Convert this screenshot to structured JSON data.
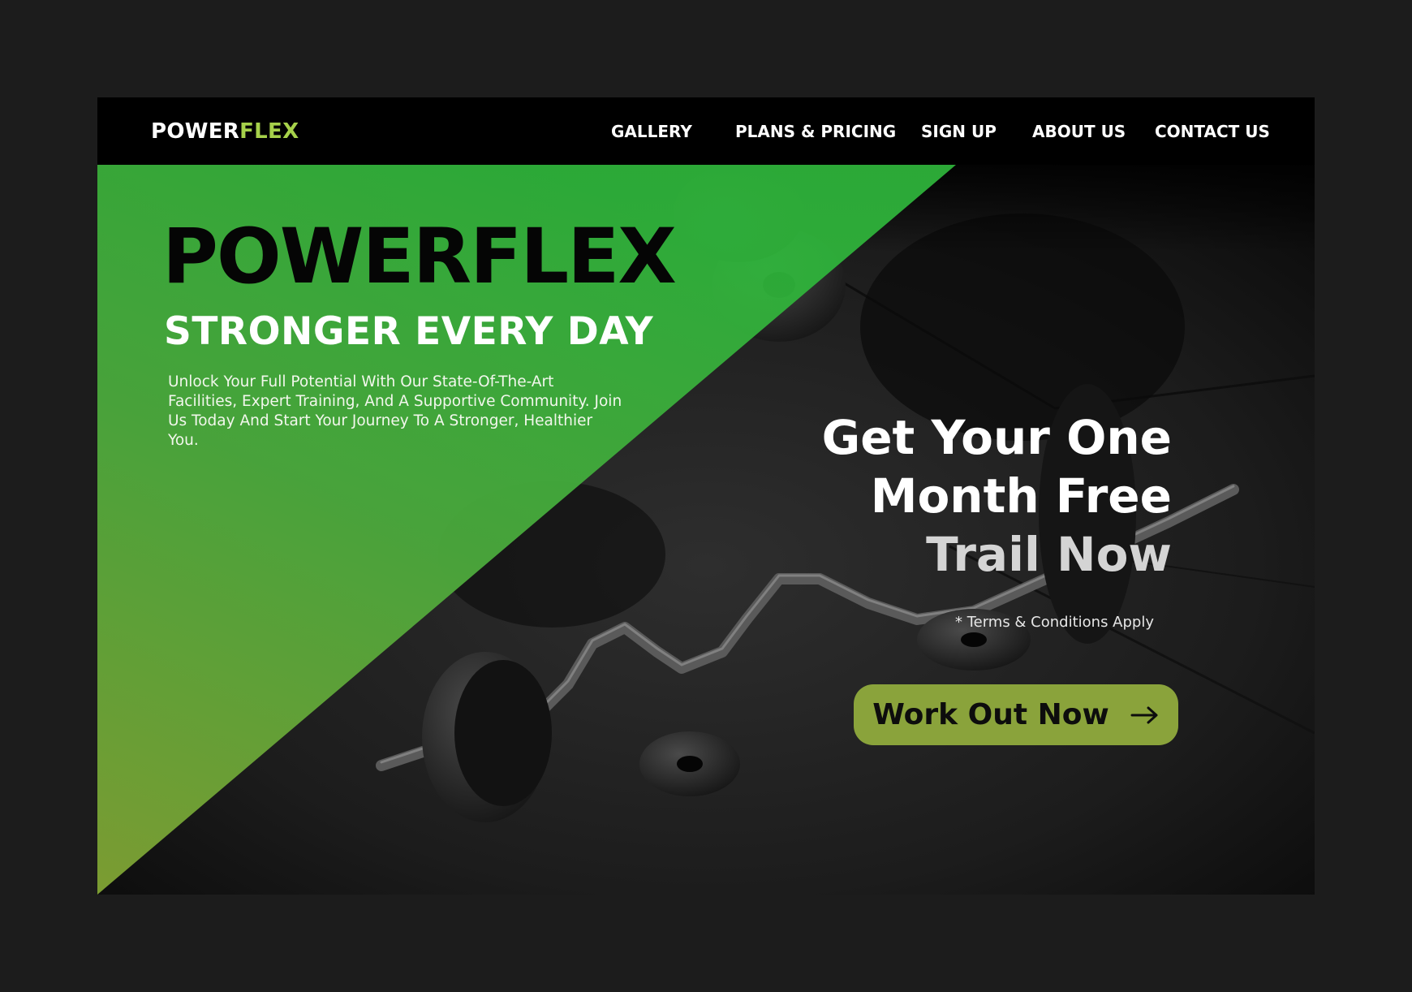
{
  "nav": {
    "brand_main": "POWER",
    "brand_accent": "FLEX",
    "links": [
      {
        "label": "GALLERY"
      },
      {
        "label": "PLANS & PRICING"
      },
      {
        "label": "SIGN UP"
      },
      {
        "label": "ABOUT US"
      },
      {
        "label": "CONTACT US"
      }
    ]
  },
  "hero": {
    "title": "POWERFLEX",
    "subtitle": "STRONGER EVERY DAY",
    "description": "Unlock Your Full Potential With Our State-Of-The-Art Facilities, Expert Training, And A Supportive Community. Join Us Today And Start Your Journey To A Stronger, Healthier You.",
    "offer_line1": "Get Your One",
    "offer_line2": "Month Free",
    "offer_line3": "Trail Now",
    "terms": "* Terms & Conditions Apply",
    "cta_label": "Work Out Now",
    "cta_icon": "arrow-right-icon"
  },
  "colors": {
    "page_bg": "#1c1c1c",
    "brand_accent": "#a6d14a",
    "wedge_green": "#45b43a",
    "wedge_olive": "#7fa033",
    "cta_bg": "#8aa33b"
  }
}
